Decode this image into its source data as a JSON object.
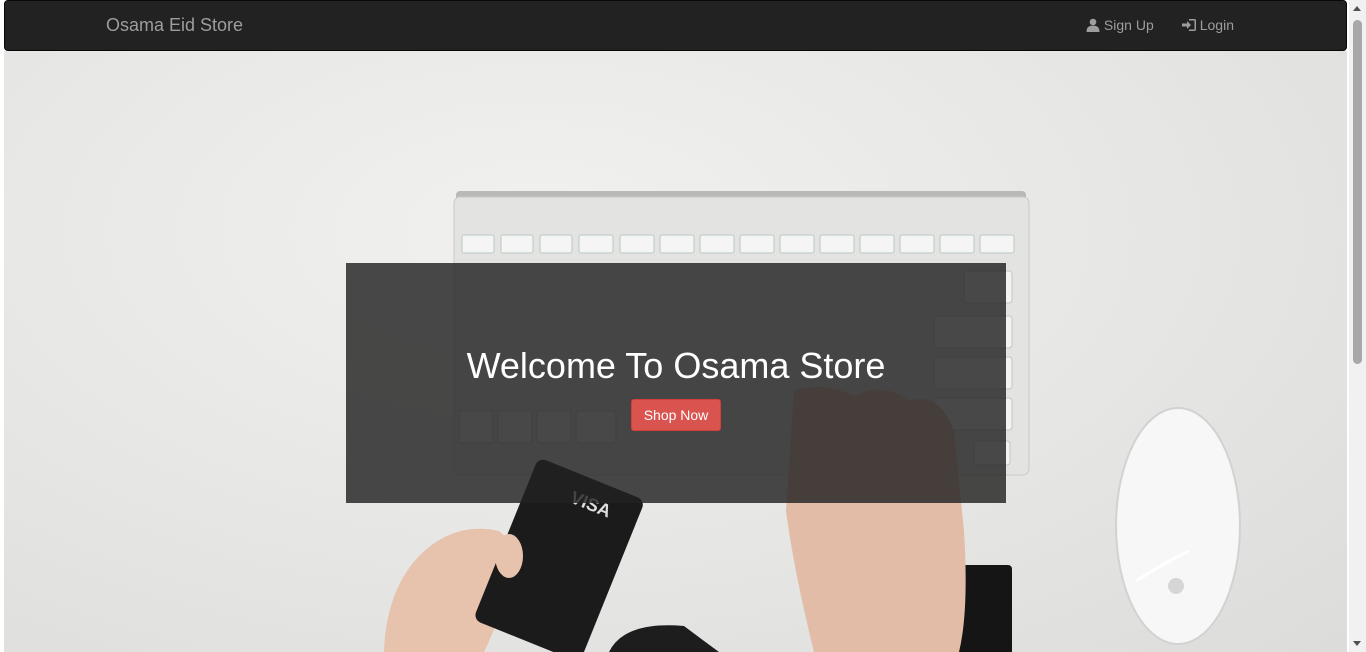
{
  "navbar": {
    "brand": "Osama Eid Store",
    "links": [
      {
        "label": "Sign Up",
        "icon": "user-icon"
      },
      {
        "label": "Login",
        "icon": "login-icon"
      }
    ]
  },
  "hero": {
    "title": "Welcome To Osama Store",
    "button_label": "Shop Now",
    "background_image": "desk-with-keyboard-mouse-and-credit-card",
    "card_text": "VISA"
  },
  "colors": {
    "navbar_bg": "#222222",
    "nav_text": "#9d9d9d",
    "button_bg": "#d9534f",
    "overlay_bg": "#222222"
  }
}
